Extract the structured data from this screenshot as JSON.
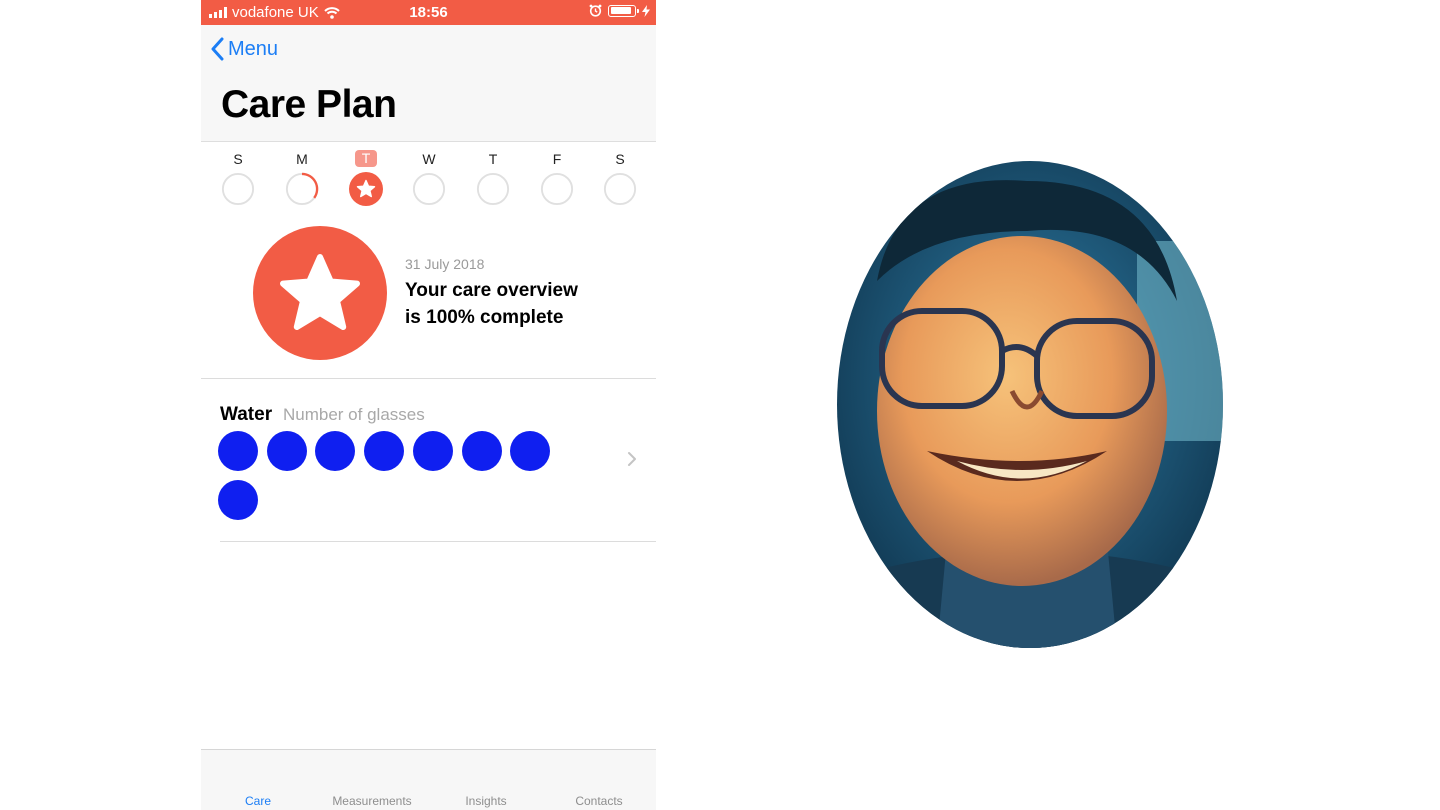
{
  "status_bar": {
    "carrier": "vodafone UK",
    "time": "18:56"
  },
  "nav": {
    "back_label": "Menu",
    "title": "Care Plan"
  },
  "week": {
    "days": [
      {
        "letter": "S",
        "progress": 0
      },
      {
        "letter": "M",
        "progress": 0.35
      },
      {
        "letter": "T",
        "progress": 1,
        "today": true
      },
      {
        "letter": "W",
        "progress": 0
      },
      {
        "letter": "T",
        "progress": 0
      },
      {
        "letter": "F",
        "progress": 0
      },
      {
        "letter": "S",
        "progress": 0
      }
    ]
  },
  "overview": {
    "date": "31 July 2018",
    "line1": "Your care overview",
    "line2": "is 100% complete",
    "completion_percent": 100
  },
  "water": {
    "title": "Water",
    "subtitle": "Number of glasses",
    "glasses": 8
  },
  "tabs": [
    {
      "label": "Care",
      "active": true
    },
    {
      "label": "Measurements"
    },
    {
      "label": "Insights"
    },
    {
      "label": "Contacts"
    }
  ],
  "colors": {
    "accent": "#f25c45",
    "link": "#1c7ef5",
    "glass": "#0f1ff0"
  },
  "icons": [
    "wifi-icon",
    "alarm-icon",
    "battery-icon",
    "charging-icon",
    "back-chevron-icon",
    "star-icon",
    "chevron-right-icon"
  ]
}
